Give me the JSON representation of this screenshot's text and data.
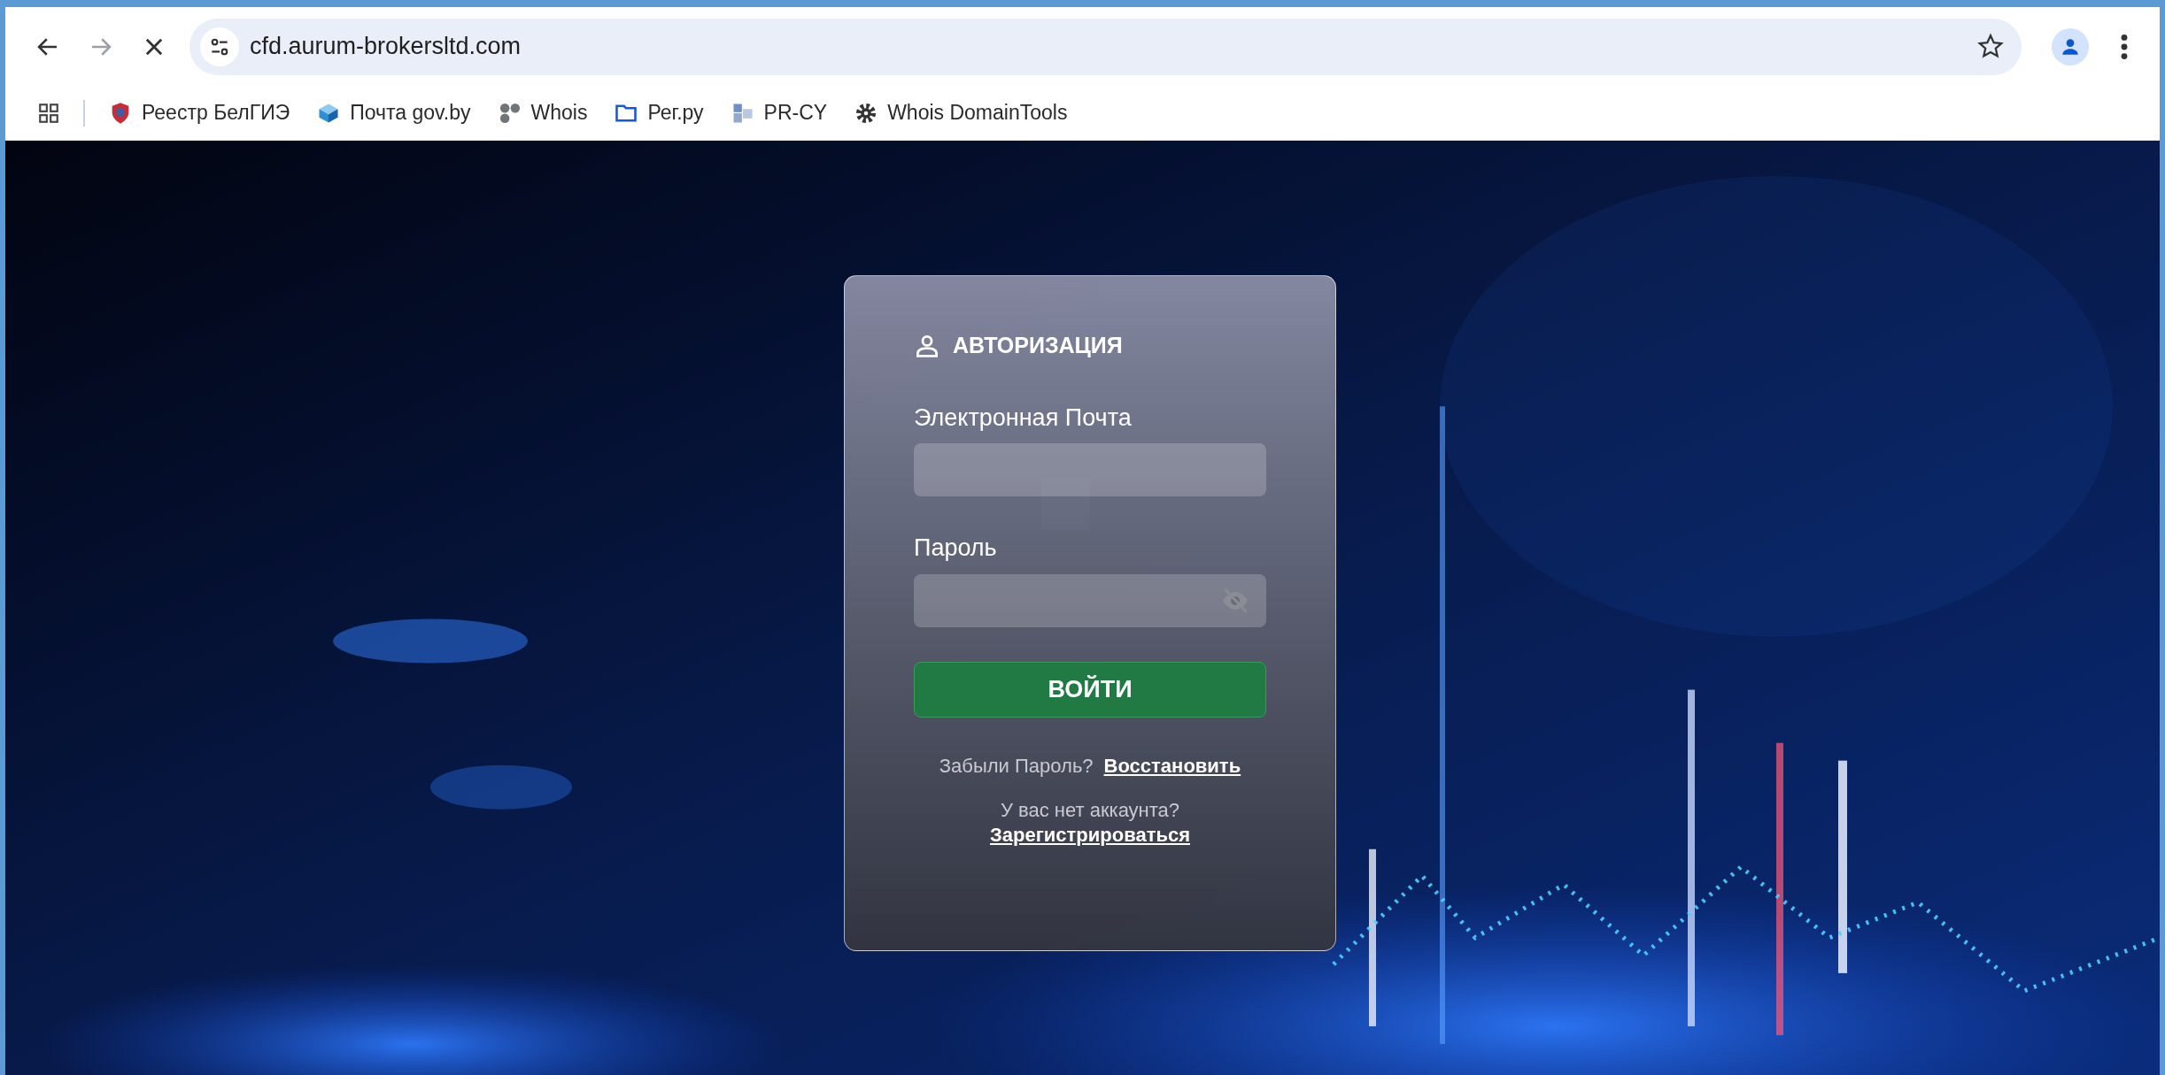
{
  "browser": {
    "loading": true,
    "address": "cfd.aurum-brokersltd.com",
    "bookmarked": false,
    "bookmarks": [
      {
        "label": "Реестр БелГИЭ",
        "kind": "shield"
      },
      {
        "label": "Почта gov.by",
        "kind": "cube"
      },
      {
        "label": "Whois",
        "kind": "dots"
      },
      {
        "label": "Рег.ру",
        "kind": "folder"
      },
      {
        "label": "PR-CY",
        "kind": "tiles"
      },
      {
        "label": "Whois DomainTools",
        "kind": "gear"
      }
    ]
  },
  "login": {
    "title": "АВТОРИЗАЦИЯ",
    "fields": [
      {
        "label": "Электронная Почта",
        "kind": "text"
      },
      {
        "label": "Пароль",
        "kind": "password"
      }
    ],
    "submit": "ВОЙТИ",
    "forgot": {
      "text": "Забыли Пароль?",
      "link": "Восстановить"
    },
    "signup": {
      "text": "У вас нет аккаунта?",
      "link": "Зарегистрироваться"
    }
  }
}
